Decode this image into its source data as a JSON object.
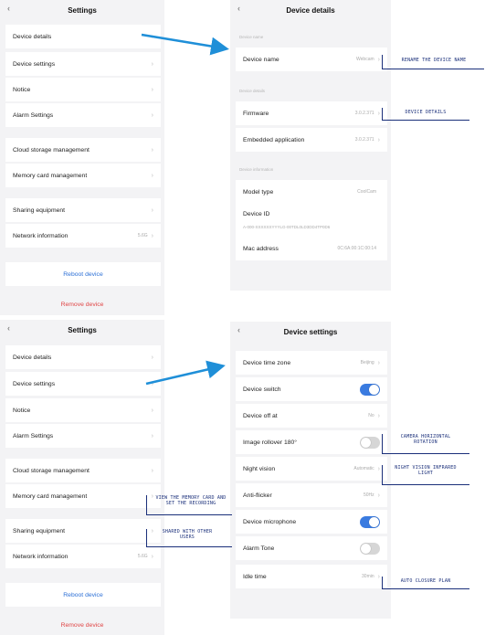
{
  "settings_top": {
    "title": "Settings",
    "back": "‹",
    "items": [
      {
        "label": "Device details"
      },
      {
        "label": "Device settings"
      },
      {
        "label": "Notice"
      },
      {
        "label": "Alarm Settings"
      },
      {
        "label": "Cloud storage management"
      },
      {
        "label": "Memory card management"
      },
      {
        "label": "Sharing equipment"
      },
      {
        "label": "Network information",
        "value": "5.6G"
      }
    ],
    "reboot": "Reboot device",
    "remove": "Remove device"
  },
  "device_details": {
    "title": "Device details",
    "back": "‹",
    "section_name": "Device name",
    "device_name_label": "Device name",
    "device_name_value": "Webcam",
    "section_device": "Device details",
    "firmware_label": "Firmware",
    "firmware_value": "3.0.2.371",
    "embedded_label": "Embedded application",
    "embedded_value": "3.0.2.371",
    "section_hw": "Device information",
    "model_label": "Model type",
    "model_value": "CoolCam",
    "device_id_label": "Device ID",
    "device_id_value": "A-000-XXXXXXYYYLG-00TDL0LD3DD4TP0D6",
    "mac_label": "Mac address",
    "mac_value": "0C:6A:00:1C:00:14"
  },
  "settings_bottom": {
    "title": "Settings",
    "back": "‹",
    "items": [
      {
        "label": "Device details"
      },
      {
        "label": "Device settings"
      },
      {
        "label": "Notice"
      },
      {
        "label": "Alarm Settings"
      },
      {
        "label": "Cloud storage management"
      },
      {
        "label": "Memory card management"
      },
      {
        "label": "Sharing equipment"
      },
      {
        "label": "Network information",
        "value": "5.6G"
      }
    ],
    "reboot": "Reboot device",
    "remove": "Remove device"
  },
  "device_settings": {
    "title": "Device settings",
    "back": "‹",
    "time_zone_label": "Device time zone",
    "time_zone_value": "Beijing",
    "switch_label": "Device switch",
    "switch_on": true,
    "off_at_label": "Device off at",
    "off_at_value": "No",
    "rollover_label": "Image rollover 180°",
    "rollover_on": false,
    "night_label": "Night vision",
    "night_value": "Automatic",
    "flicker_label": "Anti-flicker",
    "flicker_value": "50Hz",
    "mic_label": "Device microphone",
    "mic_on": true,
    "alarm_tone_label": "Alarm Tone",
    "alarm_tone_on": false,
    "idle_label": "Idle time",
    "idle_value": "30min"
  },
  "annotations": {
    "rename": "RENAME THE DEVICE NAME",
    "details": "DEVICE DETAILS",
    "rotation": "CAMERA HORIZONTAL ROTATION",
    "night": "NIGHT VISION INFRARED LIGHT",
    "memory": "VIEW THE MEMORY CARD AND SET THE RECORDING",
    "share": "SHARED WITH OTHER USERS",
    "idle": "AUTO CLOSURE PLAN"
  },
  "colors": {
    "link_blue": "#2b6fd6",
    "remove_red": "#e04646",
    "toggle_on": "#3a7be0",
    "arrow": "#1f8fd8",
    "note_ink": "#1a2f7a"
  }
}
